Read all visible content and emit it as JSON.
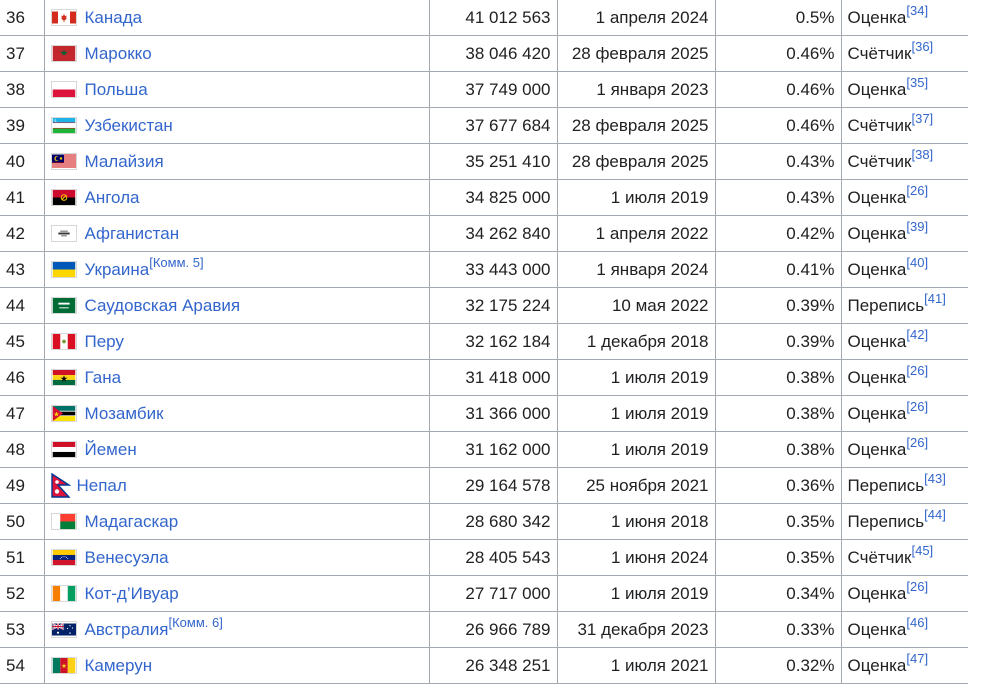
{
  "rows": [
    {
      "rank": "36",
      "flag": "canada",
      "country": "Канада",
      "note": "",
      "population": "41 012 563",
      "date": "1 апреля 2024",
      "percent": "0.5%",
      "source": "Оценка",
      "ref": "[34]"
    },
    {
      "rank": "37",
      "flag": "morocco",
      "country": "Марокко",
      "note": "",
      "population": "38 046 420",
      "date": "28 февраля 2025",
      "percent": "0.46%",
      "source": "Счётчик",
      "ref": "[36]"
    },
    {
      "rank": "38",
      "flag": "poland",
      "country": "Польша",
      "note": "",
      "population": "37 749 000",
      "date": "1 января 2023",
      "percent": "0.46%",
      "source": "Оценка",
      "ref": "[35]"
    },
    {
      "rank": "39",
      "flag": "uzbekistan",
      "country": "Узбекистан",
      "note": "",
      "population": "37 677 684",
      "date": "28 февраля 2025",
      "percent": "0.46%",
      "source": "Счётчик",
      "ref": "[37]"
    },
    {
      "rank": "40",
      "flag": "malaysia",
      "country": "Малайзия",
      "note": "",
      "population": "35 251 410",
      "date": "28 февраля 2025",
      "percent": "0.43%",
      "source": "Счётчик",
      "ref": "[38]"
    },
    {
      "rank": "41",
      "flag": "angola",
      "country": "Ангола",
      "note": "",
      "population": "34 825 000",
      "date": "1 июля 2019",
      "percent": "0.43%",
      "source": "Оценка",
      "ref": "[26]"
    },
    {
      "rank": "42",
      "flag": "afghanistan",
      "country": "Афганистан",
      "note": "",
      "population": "34 262 840",
      "date": "1 апреля 2022",
      "percent": "0.42%",
      "source": "Оценка",
      "ref": "[39]"
    },
    {
      "rank": "43",
      "flag": "ukraine",
      "country": "Украина",
      "note": "[Комм. 5]",
      "population": "33 443 000",
      "date": "1 января 2024",
      "percent": "0.41%",
      "source": "Оценка",
      "ref": "[40]"
    },
    {
      "rank": "44",
      "flag": "saudi",
      "country": "Саудовская Аравия",
      "note": "",
      "population": "32 175 224",
      "date": "10 мая 2022",
      "percent": "0.39%",
      "source": "Перепись",
      "ref": "[41]"
    },
    {
      "rank": "45",
      "flag": "peru",
      "country": "Перу",
      "note": "",
      "population": "32 162 184",
      "date": "1 декабря 2018",
      "percent": "0.39%",
      "source": "Оценка",
      "ref": "[42]"
    },
    {
      "rank": "46",
      "flag": "ghana",
      "country": "Гана",
      "note": "",
      "population": "31 418 000",
      "date": "1 июля 2019",
      "percent": "0.38%",
      "source": "Оценка",
      "ref": "[26]"
    },
    {
      "rank": "47",
      "flag": "mozambique",
      "country": "Мозамбик",
      "note": "",
      "population": "31 366 000",
      "date": "1 июля 2019",
      "percent": "0.38%",
      "source": "Оценка",
      "ref": "[26]"
    },
    {
      "rank": "48",
      "flag": "yemen",
      "country": "Йемен",
      "note": "",
      "population": "31 162 000",
      "date": "1 июля 2019",
      "percent": "0.38%",
      "source": "Оценка",
      "ref": "[26]"
    },
    {
      "rank": "49",
      "flag": "nepal",
      "country": "Непал",
      "note": "",
      "population": "29 164 578",
      "date": "25 ноября 2021",
      "percent": "0.36%",
      "source": "Перепись",
      "ref": "[43]"
    },
    {
      "rank": "50",
      "flag": "madagascar",
      "country": "Мадагаскар",
      "note": "",
      "population": "28 680 342",
      "date": "1 июня 2018",
      "percent": "0.35%",
      "source": "Перепись",
      "ref": "[44]"
    },
    {
      "rank": "51",
      "flag": "venezuela",
      "country": "Венесуэла",
      "note": "",
      "population": "28 405 543",
      "date": "1 июня 2024",
      "percent": "0.35%",
      "source": "Счётчик",
      "ref": "[45]"
    },
    {
      "rank": "52",
      "flag": "ivorycoast",
      "country": "Кот-д’Ивуар",
      "note": "",
      "population": "27 717 000",
      "date": "1 июля 2019",
      "percent": "0.34%",
      "source": "Оценка",
      "ref": "[26]"
    },
    {
      "rank": "53",
      "flag": "australia",
      "country": "Австралия",
      "note": "[Комм. 6]",
      "population": "26 966 789",
      "date": "31 декабря 2023",
      "percent": "0.33%",
      "source": "Оценка",
      "ref": "[46]"
    },
    {
      "rank": "54",
      "flag": "cameroon",
      "country": "Камерун",
      "note": "",
      "population": "26 348 251",
      "date": "1 июля 2021",
      "percent": "0.32%",
      "source": "Оценка",
      "ref": "[47]"
    }
  ]
}
